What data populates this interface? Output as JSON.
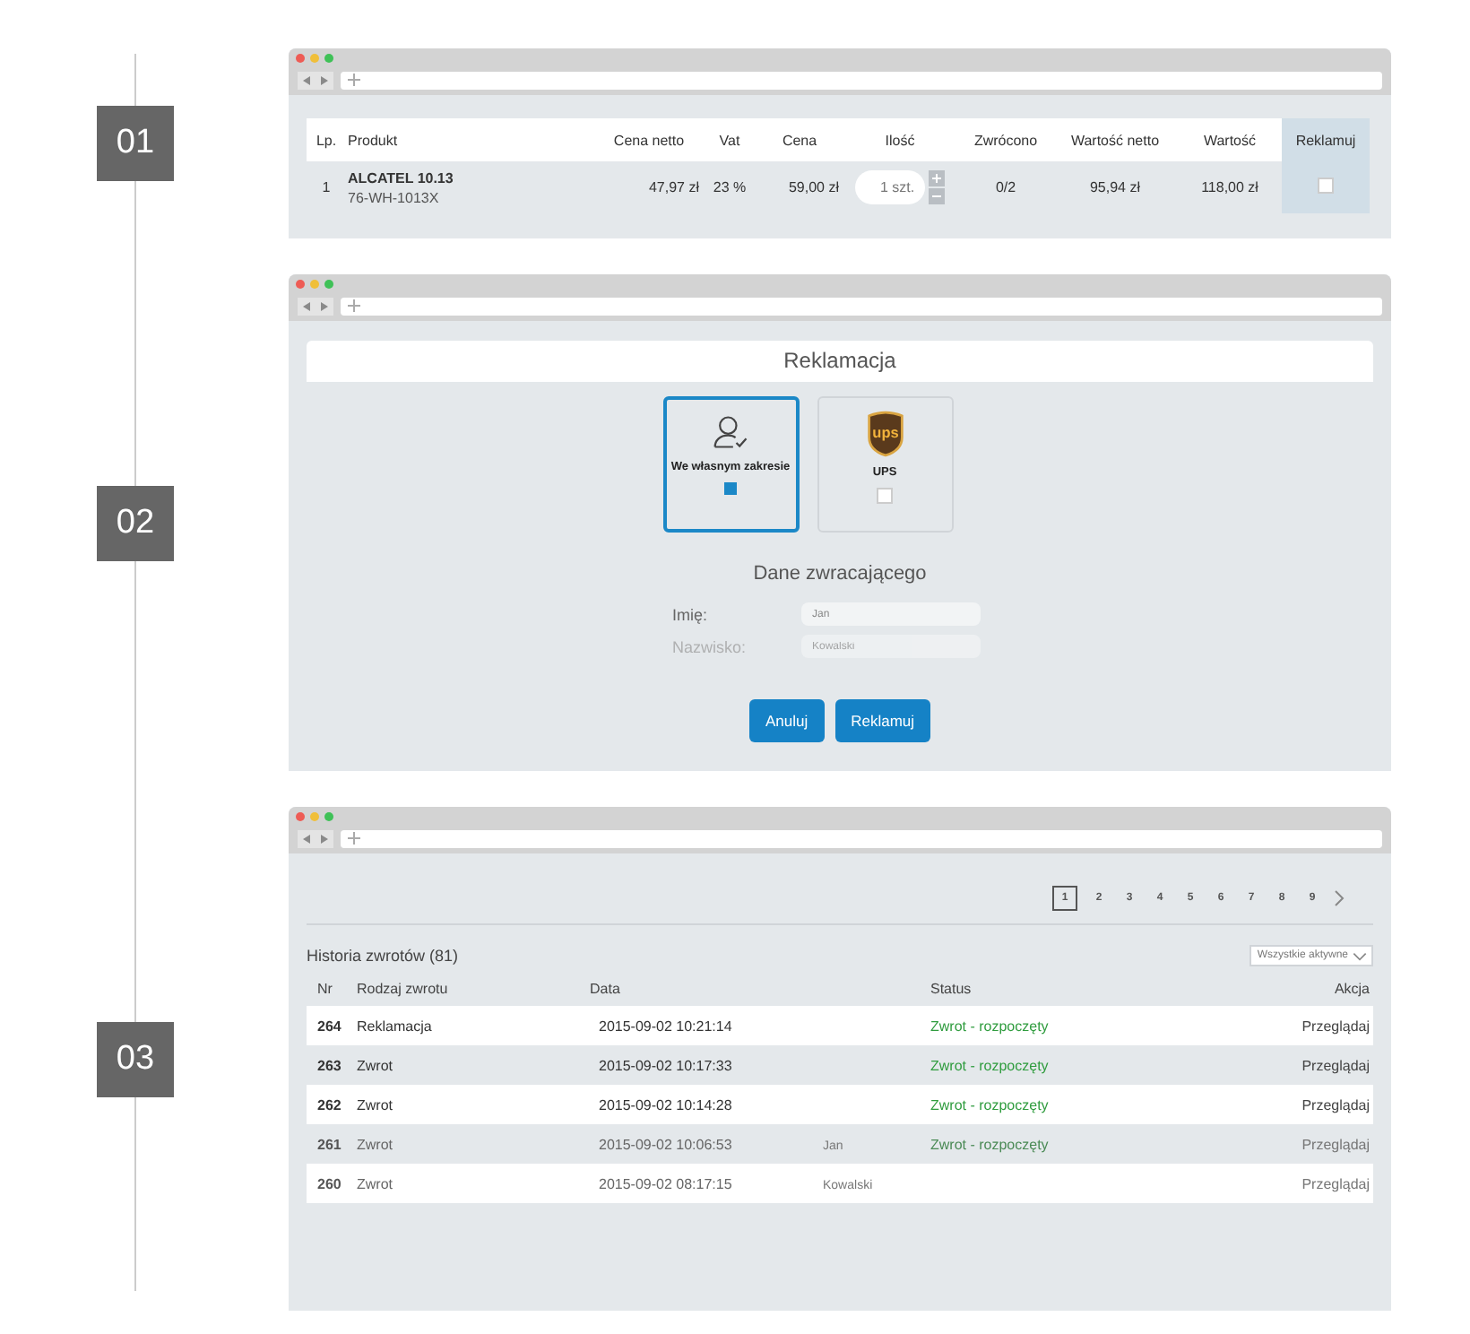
{
  "steps": [
    {
      "label": "01"
    },
    {
      "label": "02"
    },
    {
      "label": "03"
    }
  ],
  "products_table": {
    "columns": [
      "Lp.",
      "Produkt",
      "Cena netto",
      "Vat",
      "Cena",
      "Ilość",
      "Zwrócono",
      "Wartość netto",
      "Wartość",
      "Reklamuj"
    ],
    "rows": [
      {
        "lp": "1",
        "name": "ALCATEL 10.13",
        "code": "76-WH-1013X",
        "net_price": "47,97 zł",
        "vat": "23 %",
        "price": "59,00 zł",
        "quantity": "1 szt.",
        "returned": "0/2",
        "net_value": "95,94 zł",
        "value": "118,00 zł",
        "checked": false
      }
    ]
  },
  "claim_form": {
    "title": "Reklamacja",
    "options": [
      {
        "kind": "own",
        "label": "We własnym zakresie",
        "selected": true
      },
      {
        "kind": "courier",
        "label": "UPS",
        "logo_text": "ups",
        "selected": false
      }
    ],
    "section_title": "Dane zwracającego",
    "fields": [
      {
        "label": "Imię:",
        "placeholder": "Jan",
        "faded": false
      },
      {
        "label": "Nazwisko:",
        "placeholder": "Kowalski",
        "faded": true
      }
    ],
    "buttons": [
      "Anuluj",
      "Reklamuj"
    ]
  },
  "returns_history": {
    "pages": [
      {
        "label": "1",
        "selected": true
      },
      {
        "label": "2",
        "selected": false
      },
      {
        "label": "3",
        "selected": false
      },
      {
        "label": "4",
        "selected": false
      },
      {
        "label": "5",
        "selected": false
      },
      {
        "label": "6",
        "selected": false
      },
      {
        "label": "7",
        "selected": false
      },
      {
        "label": "8",
        "selected": false
      },
      {
        "label": "9",
        "selected": false
      }
    ],
    "title": "Historia zwrotów (81)",
    "filter": "Wszystkie aktywne",
    "columns": [
      "Nr",
      "Rodzaj zwrotu",
      "Data",
      "Status",
      "Akcja"
    ],
    "rows": [
      {
        "nr": "264",
        "type": "Reklamacja",
        "date": "2015-09-02 10:21:14",
        "status": "Zwrot - rozpoczęty",
        "action": "Przeglądaj",
        "faded": false
      },
      {
        "nr": "263",
        "type": "Zwrot",
        "date": "2015-09-02 10:17:33",
        "status": "Zwrot - rozpoczęty",
        "action": "Przeglądaj",
        "faded": false
      },
      {
        "nr": "262",
        "type": "Zwrot",
        "date": "2015-09-02 10:14:28",
        "status": "Zwrot - rozpoczęty",
        "action": "Przeglądaj",
        "faded": false
      },
      {
        "nr": "261",
        "type": "Zwrot",
        "date": "2015-09-02 10:06:53",
        "column_3": "Jan",
        "status": "Zwrot - rozpoczęty",
        "action": "Przeglądaj",
        "faded": true
      },
      {
        "nr": "260",
        "type": "Zwrot",
        "date": "2015-09-02 08:17:15",
        "column_3": "Kowalski",
        "action": "Przeglądaj",
        "faded": true
      }
    ]
  }
}
